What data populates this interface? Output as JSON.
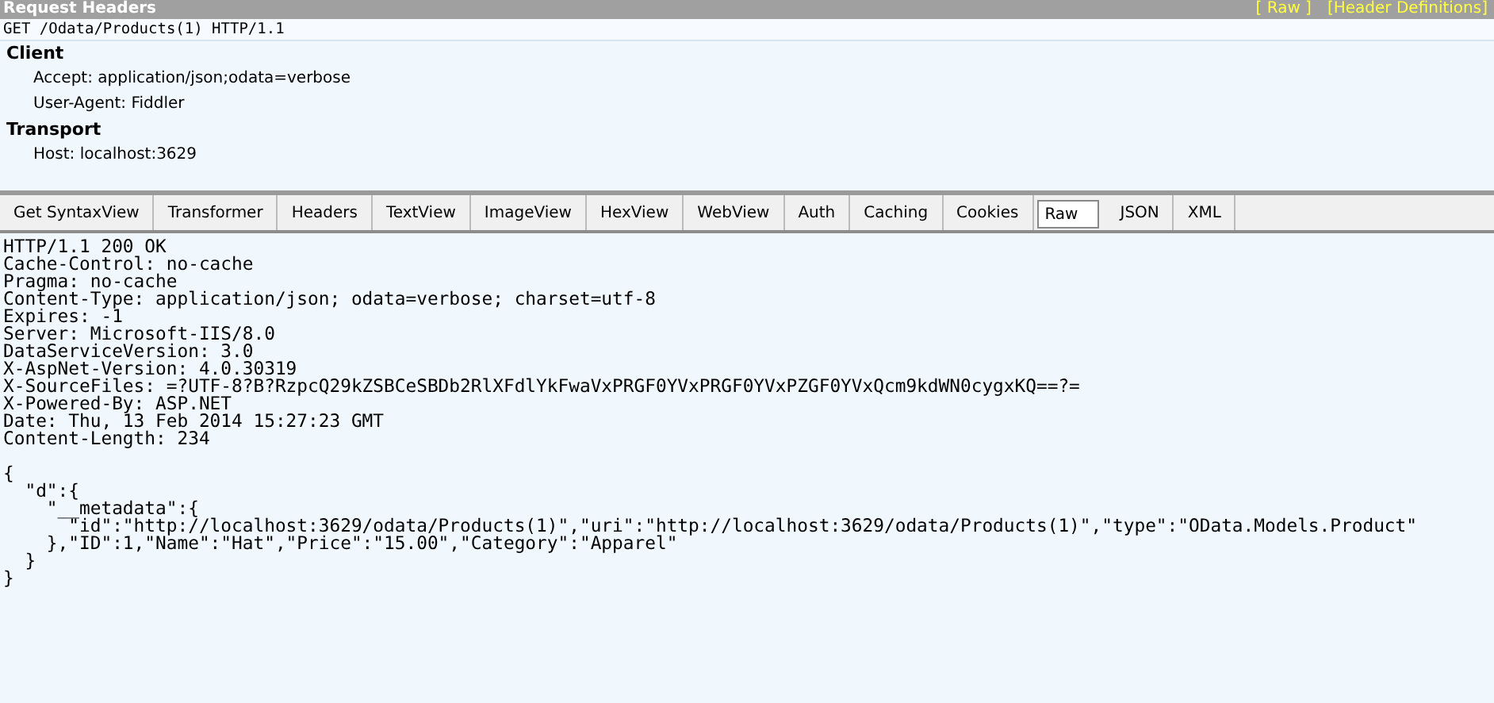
{
  "request_headers": {
    "title": "Request Headers",
    "links": [
      "[ Raw ]",
      "[Header Definitions]"
    ],
    "request_line": "GET /Odata/Products(1) HTTP/1.1",
    "groups": [
      {
        "name": "Client",
        "headers": [
          "Accept: application/json;odata=verbose",
          "User-Agent: Fiddler"
        ]
      },
      {
        "name": "Transport",
        "headers": [
          "Host: localhost:3629"
        ]
      }
    ]
  },
  "tabs": [
    {
      "label": "Get SyntaxView",
      "selected": false
    },
    {
      "label": "Transformer",
      "selected": false
    },
    {
      "label": "Headers",
      "selected": false
    },
    {
      "label": "TextView",
      "selected": false
    },
    {
      "label": "ImageView",
      "selected": false
    },
    {
      "label": "HexView",
      "selected": false
    },
    {
      "label": "WebView",
      "selected": false
    },
    {
      "label": "Auth",
      "selected": false
    },
    {
      "label": "Caching",
      "selected": false
    },
    {
      "label": "Cookies",
      "selected": false
    },
    {
      "label": "Raw",
      "selected": true
    },
    {
      "label": "JSON",
      "selected": false
    },
    {
      "label": "XML",
      "selected": false
    }
  ],
  "response_lines": [
    "HTTP/1.1 200 OK",
    "Cache-Control: no-cache",
    "Pragma: no-cache",
    "Content-Type: application/json; odata=verbose; charset=utf-8",
    "Expires: -1",
    "Server: Microsoft-IIS/8.0",
    "DataServiceVersion: 3.0",
    "X-AspNet-Version: 4.0.30319",
    "X-SourceFiles: =?UTF-8?B?RzpcQ29kZSBCeSBDb2RlXFdlYkFwaVxPRGF0YVxPRGF0YVxPZGF0YVxQcm9kdWN0cygxKQ==?=",
    "X-Powered-By: ASP.NET",
    "Date: Thu, 13 Feb 2014 15:27:23 GMT",
    "Content-Length: 234"
  ],
  "body_lines": [
    "{",
    "  \"d\":{",
    "    \"__metadata\":{",
    "      \"id\":\"http://localhost:3629/odata/Products(1)\",\"uri\":\"http://localhost:3629/odata/Products(1)\",\"type\":\"OData.Models.Product\"",
    "    },\"ID\":1,\"Name\":\"Hat\",\"Price\":\"15.00\",\"Category\":\"Apparel\"",
    "  }",
    "}"
  ]
}
